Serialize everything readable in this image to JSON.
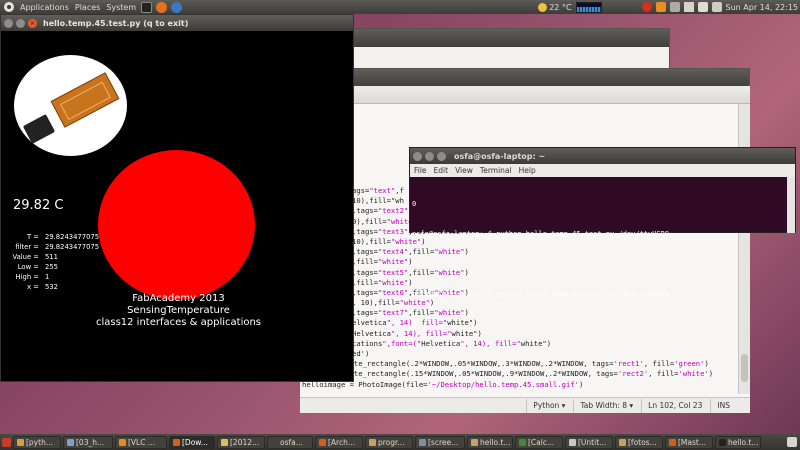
{
  "top_panel": {
    "menu": [
      "Applications",
      "Places",
      "System"
    ],
    "temperature": "22 °C",
    "clock": "Sun Apr 14, 22:15"
  },
  "main_window": {
    "title": "hello.temp.45.test.py (q to exit)",
    "temperature_display": "29.82 C",
    "stats": [
      {
        "label": "T =",
        "value": "29.8243477075"
      },
      {
        "label": "filter =",
        "value": "29.8243477075"
      },
      {
        "label": "Value =",
        "value": "511"
      },
      {
        "label": "Low =",
        "value": "255"
      },
      {
        "label": "High =",
        "value": "1"
      },
      {
        "label": "x =",
        "value": "532"
      }
    ],
    "caption_lines": [
      "FabAcademy 2013",
      "SensingTemperature",
      "class12 interfaces & applications"
    ],
    "circle_color": "#ff0000"
  },
  "terminal": {
    "title": "osfa@osfa-laptop: ~",
    "menu": [
      "File",
      "Edit",
      "View",
      "Terminal",
      "Help"
    ],
    "lines": [
      "0",
      "osfa@osfa-laptop:~$ python hello.temp.45.test.py /dev/ttyUSB0",
      "0",
      "osfa@osfa-laptop:~$ python hello.temp.45.test.py /dev/ttyUSB0",
      "█"
    ]
  },
  "editor": {
    "code_lines": [
      "ags=\"text\",f",
      "10),fill=\"wh",
      ",tags=\"text2\",fill=\"white\")",
      "0),fill=\"white\")",
      ",tags=\"text3\",fill=\"white\")",
      "10),fill=\"white\")",
      ",tags=\"text4\",fill=\"white\")",
      ",fill=\"white\")",
      ",tags=\"text5\",fill=\"white\")",
      ",fill=\"white\")",
      ",tags=\"text6\",fill=\"white\")",
      ", 10),fill=\"white\")",
      ",tags=\"text7\",fill=\"white\")",
      "elvetica\", 14), fill=\"white\")",
      "Helvetica\", 14), fill=\"white\")",
      "cations\",font=(\"Helvetica\", 14), fill=\"white\")",
      "ed')",
      "#canvas.create_rectangle(.2*WINDOW,.05*WINDOW,.3*WINDOW,.2*WINDOW, tags='rect1', fill='green')",
      "#canvas.create_rectangle(.15*WINDOW,.05*WINDOW,.9*WINDOW,.2*WINDOW, tags='rect2', fill='white')",
      "helloimage = PhotoImage(file='~/Desktop/hello.temp.45.small.gif')"
    ],
    "status": {
      "language": "Python ▾",
      "tab_width": "Tab Width: 8 ▾",
      "position": "Ln 102, Col 23",
      "mode": "INS"
    }
  },
  "taskbar": [
    {
      "label": "[pyth...",
      "color": "#d4a03c"
    },
    {
      "label": "[03_h...",
      "color": "#7aa0d0"
    },
    {
      "label": "[VLC ...",
      "color": "#e88a1c"
    },
    {
      "label": "[Dow...",
      "color": "#d0601c",
      "active": true
    },
    {
      "label": "[2012...",
      "color": "#d8c060"
    },
    {
      "label": "osfa...",
      "color": "#404040"
    },
    {
      "label": "[Arch...",
      "color": "#d0601c"
    },
    {
      "label": "progr...",
      "color": "#c8a060"
    },
    {
      "label": "[scree...",
      "color": "#8090a0"
    },
    {
      "label": "hello.t...",
      "color": "#c8a060"
    },
    {
      "label": "[Calc...",
      "color": "#3c8c3c"
    },
    {
      "label": "[Untit...",
      "color": "#c8c8c8"
    },
    {
      "label": "[fotos...",
      "color": "#c8a060"
    },
    {
      "label": "[Mast...",
      "color": "#d0601c"
    },
    {
      "label": "hello.t...",
      "color": "#222222"
    }
  ]
}
